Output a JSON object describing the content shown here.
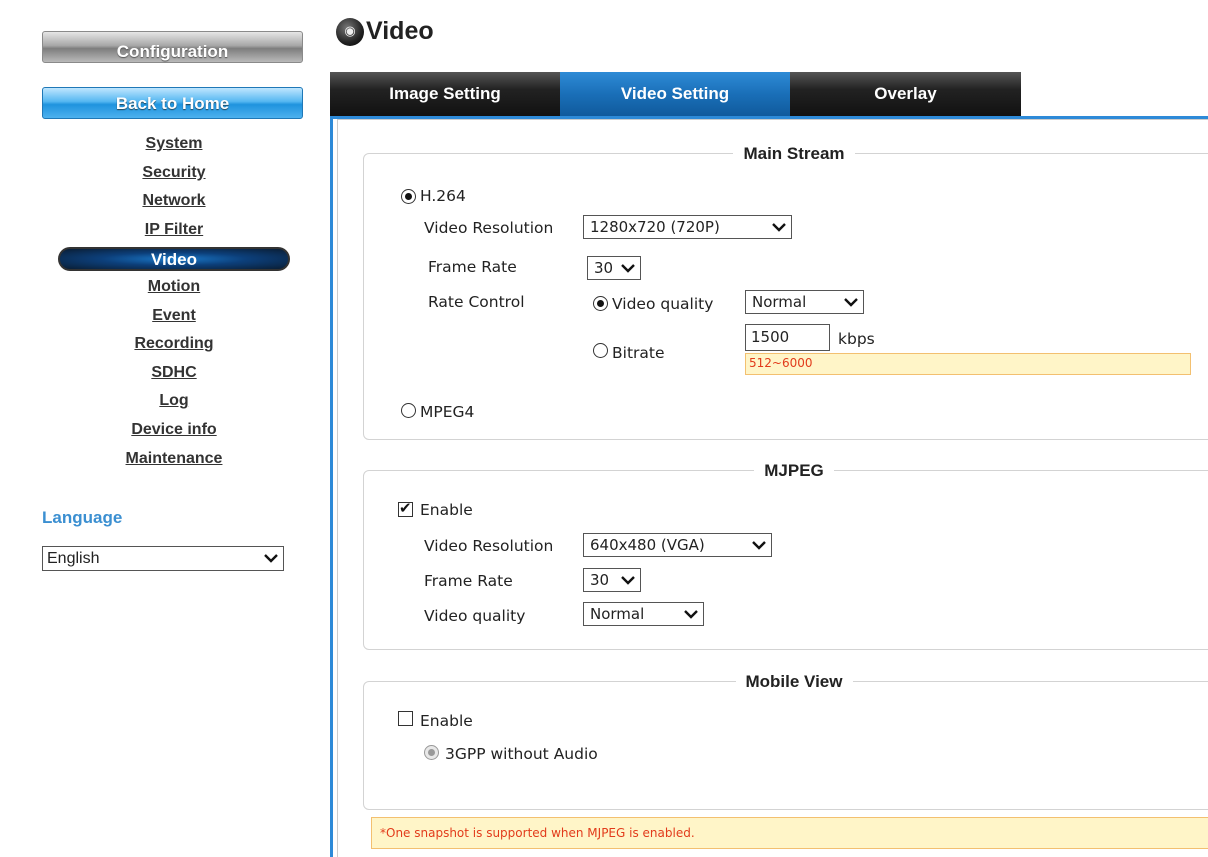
{
  "sidebar": {
    "config_label": "Configuration",
    "home_label": "Back to Home",
    "menu": [
      "System",
      "Security",
      "Network",
      "IP Filter",
      "Video",
      "Motion",
      "Event",
      "Recording",
      "SDHC",
      "Log",
      "Device info",
      "Maintenance"
    ],
    "active_item": "Video",
    "language_title": "Language",
    "language_value": "English"
  },
  "page": {
    "title": "Video",
    "title_icon": "camera-icon"
  },
  "tabs": [
    "Image Setting",
    "Video Setting",
    "Overlay"
  ],
  "active_tab": "Video Setting",
  "main_stream": {
    "legend": "Main Stream",
    "h264_label": "H.264",
    "h264_selected": true,
    "resolution_label": "Video Resolution",
    "resolution_value": "1280x720 (720P)",
    "frame_rate_label": "Frame Rate",
    "frame_rate_value": "30",
    "rate_control_label": "Rate Control",
    "video_quality_label": "Video quality",
    "video_quality_value": "Normal",
    "bitrate_label": "Bitrate",
    "bitrate_value": "1500",
    "bitrate_unit": "kbps",
    "bitrate_range": "512~6000",
    "mpeg4_label": "MPEG4"
  },
  "mjpeg": {
    "legend": "MJPEG",
    "enable_label": "Enable",
    "enabled": true,
    "resolution_label": "Video Resolution",
    "resolution_value": "640x480 (VGA)",
    "frame_rate_label": "Frame Rate",
    "frame_rate_value": "30",
    "quality_label": "Video quality",
    "quality_value": "Normal"
  },
  "mobile_view": {
    "legend": "Mobile View",
    "enable_label": "Enable",
    "enabled": false,
    "format_label": "3GPP without Audio"
  },
  "note": "*One snapshot is supported when MJPEG is enabled.",
  "colors": {
    "accent": "#2d8ad8",
    "tab_active": "#1a6fb8",
    "language": "#3b8fd1",
    "warning_text": "#e23b1b",
    "warning_bg": "#fff5c8"
  }
}
